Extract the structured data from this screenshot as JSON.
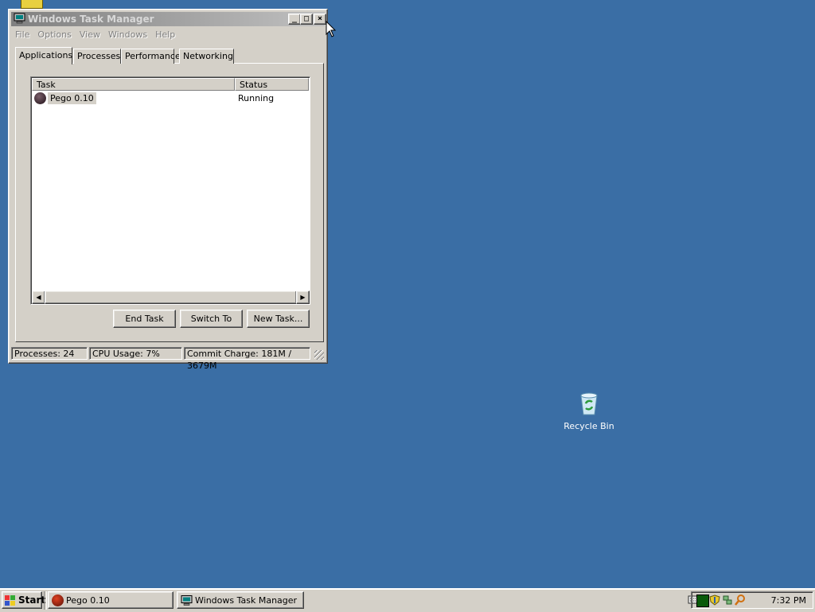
{
  "window": {
    "title": "Windows Task Manager",
    "caption_buttons": {
      "minimize": "_",
      "maximize": "□",
      "close": "×"
    },
    "menu": [
      "File",
      "Options",
      "View",
      "Windows",
      "Help"
    ],
    "tabs": [
      "Applications",
      "Processes",
      "Performance",
      "Networking"
    ],
    "active_tab": "Applications",
    "list": {
      "columns": [
        "Task",
        "Status"
      ],
      "rows": [
        {
          "task": "Pego 0.10",
          "status": "Running"
        }
      ]
    },
    "buttons": {
      "end_task": "End Task",
      "switch_to": "Switch To",
      "new_task": "New Task..."
    },
    "statusbar": {
      "processes": "Processes: 24",
      "cpu": "CPU Usage: 7%",
      "commit": "Commit Charge: 181M / 3679M"
    }
  },
  "desktop": {
    "background_color": "#3a6ea5",
    "icons": [
      {
        "label": "Recycle Bin",
        "icon": "recycle-bin-icon"
      }
    ]
  },
  "taskbar": {
    "start_label": "Start",
    "tasks": [
      {
        "label": "Pego 0.10",
        "icon": "pego-icon"
      },
      {
        "label": "Windows Task Manager",
        "icon": "task-manager-icon"
      }
    ],
    "clock": "7:32 PM",
    "tray_icons": [
      "keyboard-icon",
      "cpu-meter-icon",
      "shield-icon",
      "network-icon",
      "search-icon"
    ]
  }
}
